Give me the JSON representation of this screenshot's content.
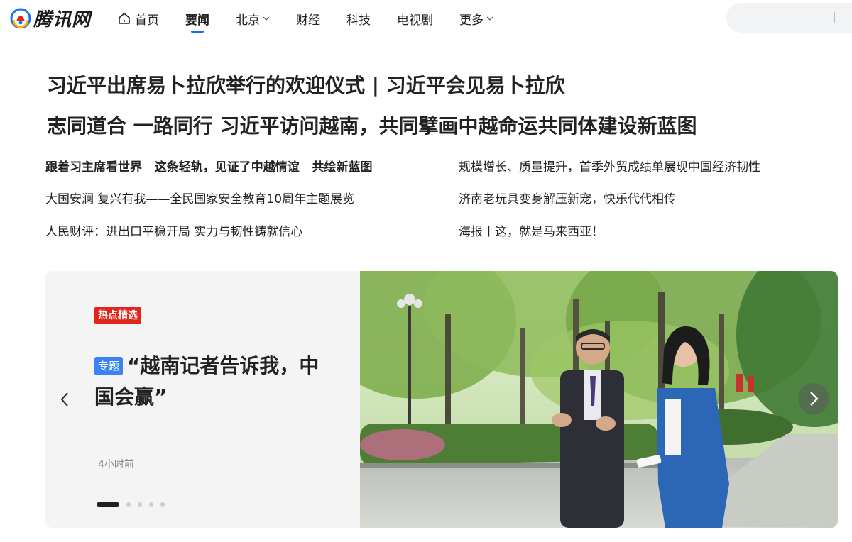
{
  "header": {
    "logo_text": "腾讯网",
    "nav": [
      {
        "label": "首页"
      },
      {
        "label": "要闻"
      },
      {
        "label": "北京"
      },
      {
        "label": "财经"
      },
      {
        "label": "科技"
      },
      {
        "label": "电视剧"
      },
      {
        "label": "更多"
      }
    ],
    "search_placeholder": ""
  },
  "headlines": {
    "main1": "习近平出席易卜拉欣举行的欢迎仪式 | 习近平会见易卜拉欣",
    "main2": "志同道合 一路同行  习近平访问越南，共同擘画中越命运共同体建设新蓝图"
  },
  "news": {
    "left": [
      "跟着习主席看世界   这条轻轨，见证了中越情谊   共绘新蓝图",
      "大国安澜 复兴有我——全民国家安全教育10周年主题展览",
      "人民财评：进出口平稳开局 实力与韧性铸就信心"
    ],
    "right": [
      "规模增长、质量提升，首季外贸成绩单展现中国经济韧性",
      "济南老玩具变身解压新宠，快乐代代相传",
      "海报丨这，就是马来西亚！"
    ]
  },
  "carousel": {
    "hot_badge": "热点精选",
    "topic_tag": "专题",
    "title": "“越南记者告诉我，中国会赢”",
    "time": "4小时前",
    "slide_count": 5,
    "active_slide": 1
  },
  "colors": {
    "accent": "#1b6ef3",
    "hot_badge": "#e1251b",
    "topic_tag": "#3b82f6"
  }
}
